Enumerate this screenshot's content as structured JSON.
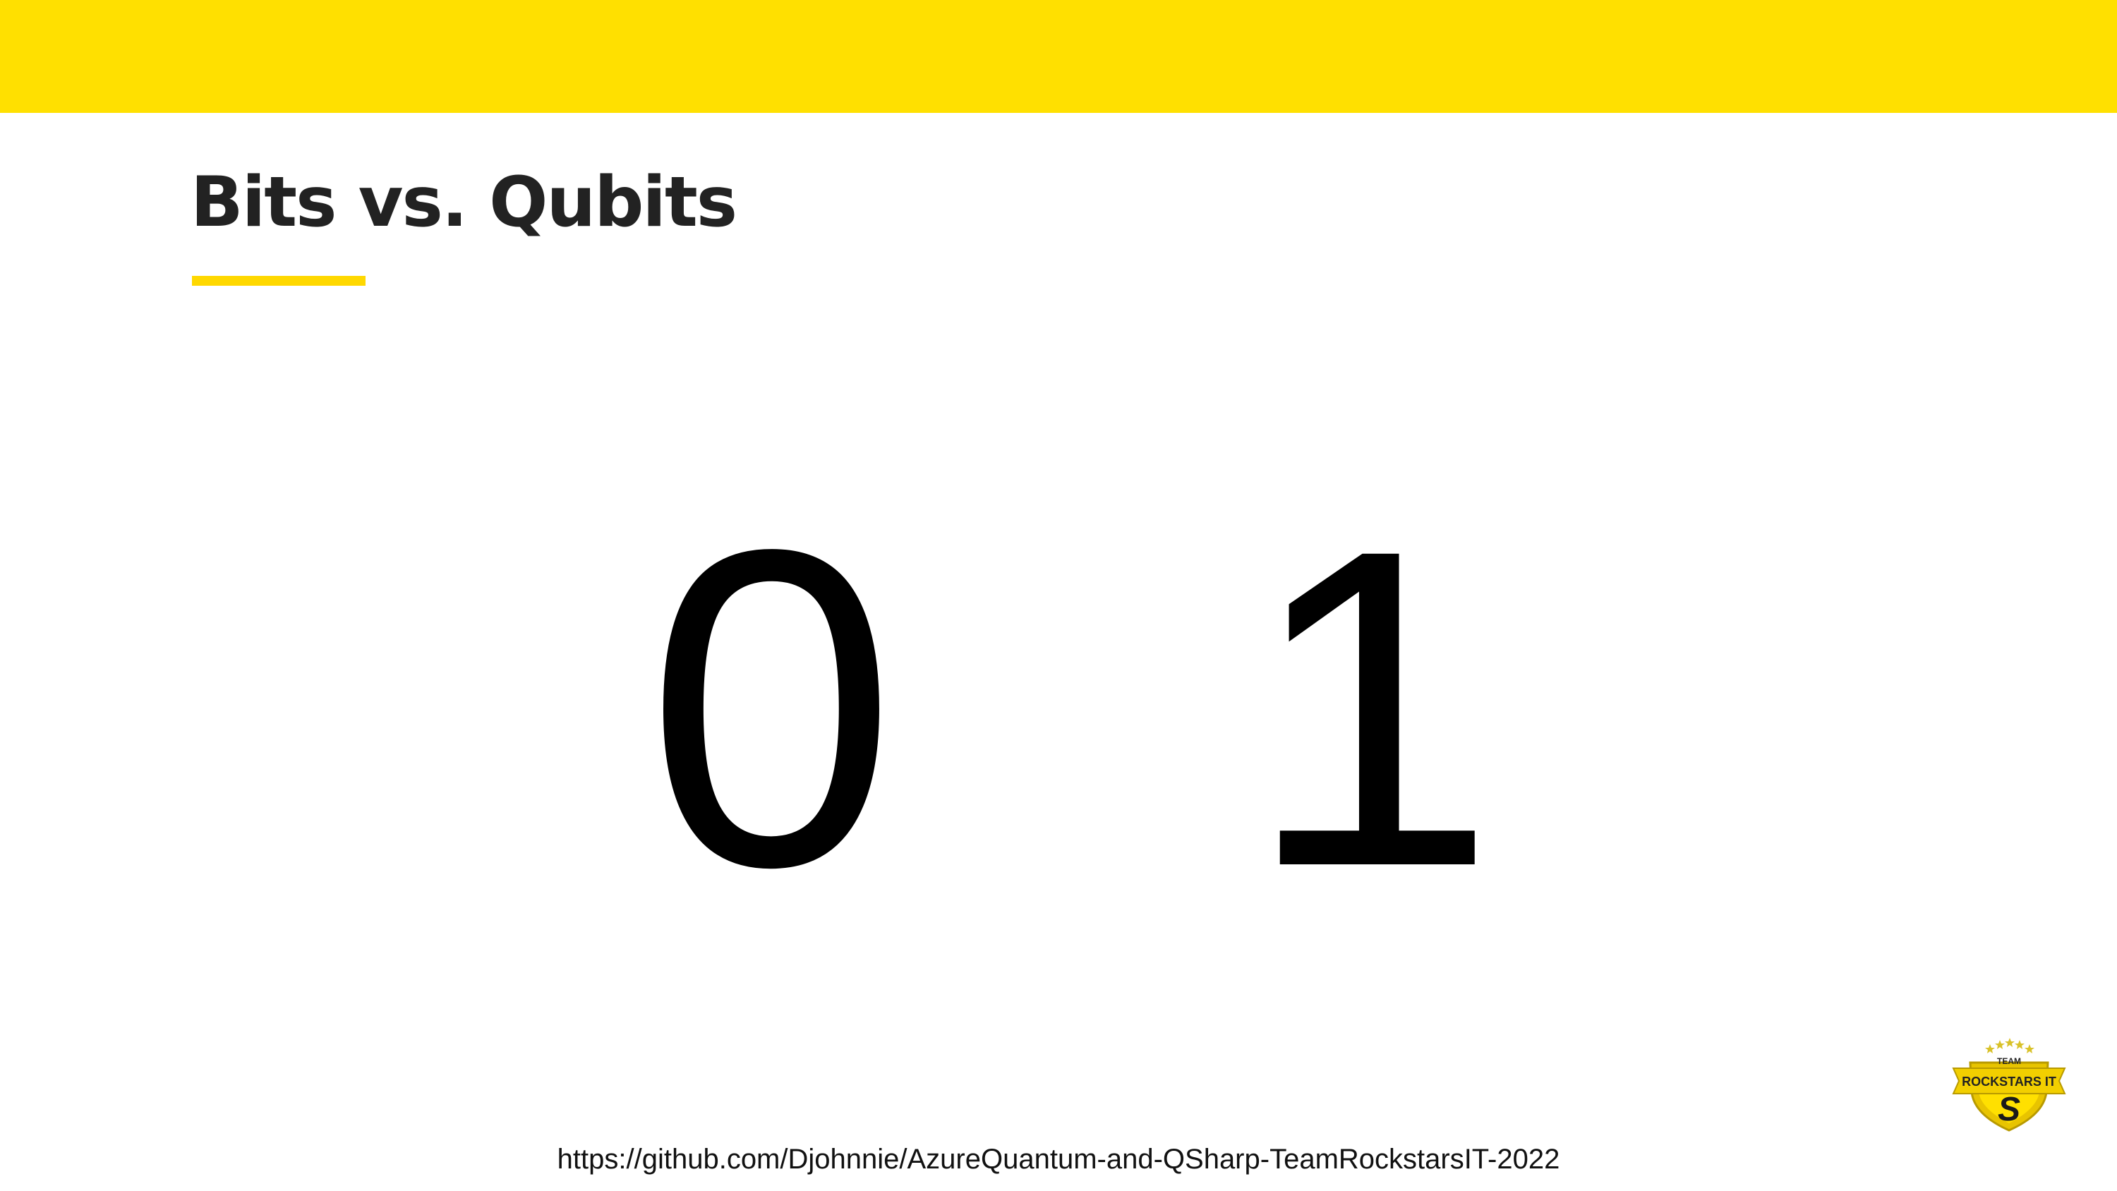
{
  "slide": {
    "title": "Bits vs. Qubits",
    "digits": [
      "0",
      "1"
    ],
    "footer_url": "https://github.com/Djohnnie/AzureQuantum-and-QSharp-TeamRockstarsIT-2022"
  },
  "logo": {
    "icon": "team-rockstars-it-badge",
    "top_text": "TEAM",
    "main_text": "ROCKSTARS IT",
    "letter": "S"
  },
  "colors": {
    "accent": "#ffe000",
    "title": "#222222",
    "text": "#000000",
    "background": "#ffffff"
  }
}
